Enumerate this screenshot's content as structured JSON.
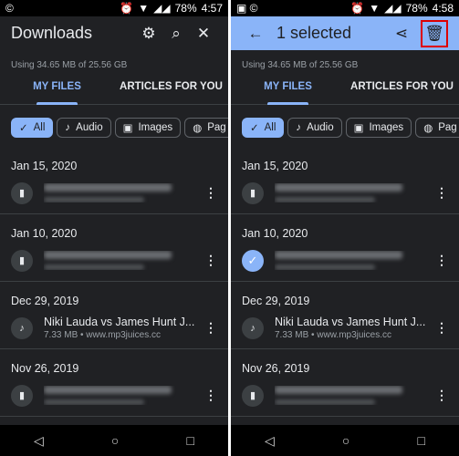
{
  "usage": "Using 34.65 MB of 25.56 GB",
  "tabs": [
    "MY FILES",
    "ARTICLES FOR YOU"
  ],
  "chips": [
    "All",
    "Audio",
    "Images",
    "Pag"
  ],
  "battery": "78%",
  "left": {
    "time": "4:57",
    "title": "Downloads"
  },
  "right": {
    "time": "4:58",
    "title": "1 selected"
  },
  "sections": [
    {
      "date": "Jan 15, 2020"
    },
    {
      "date": "Jan 10, 2020"
    },
    {
      "date": "Dec 29, 2019",
      "name": "Niki Lauda vs James Hunt J...",
      "sub": "7.33 MB • www.mp3juices.cc"
    },
    {
      "date": "Nov 26, 2019"
    }
  ],
  "colors": {
    "accent": "#8ab4f8",
    "bg": "#202124",
    "highlight": "#dd0000"
  }
}
